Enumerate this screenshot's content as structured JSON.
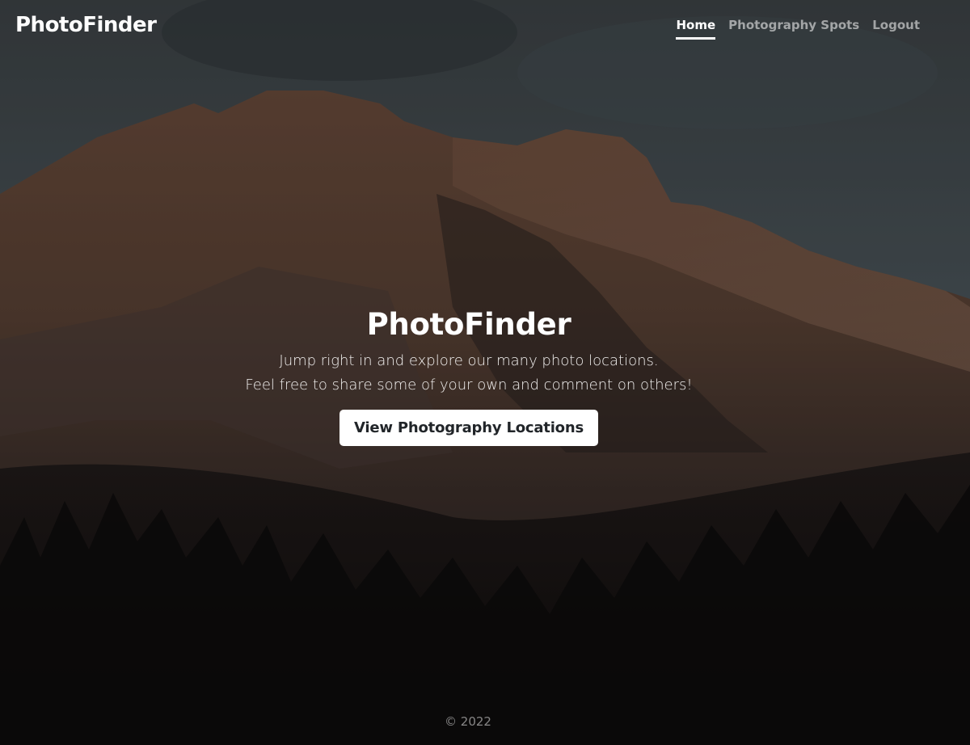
{
  "navbar": {
    "brand": "PhotoFinder",
    "links": [
      {
        "label": "Home"
      },
      {
        "label": "Photography Spots"
      },
      {
        "label": "Logout"
      }
    ]
  },
  "hero": {
    "title": "PhotoFinder",
    "line1": "Jump right in and explore our many photo locations.",
    "line2": "Feel free to share some of your own and comment on others!",
    "button_label": "View Photography Locations"
  },
  "footer": {
    "copyright": "© 2022"
  },
  "colors": {
    "sky": "#505a60",
    "mountain": "#5e4538",
    "forest": "#121010",
    "button_bg": "#ffffff",
    "button_text": "#212529"
  }
}
